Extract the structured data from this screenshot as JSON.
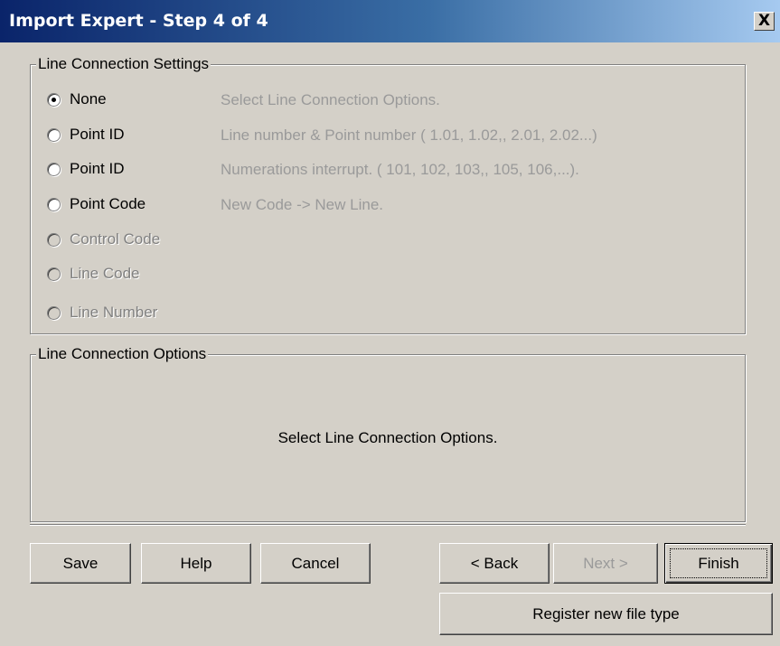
{
  "window": {
    "title": "Import Expert - Step 4 of 4",
    "close_glyph": "X"
  },
  "settings_group": {
    "legend": "Line Connection Settings",
    "options": [
      {
        "label": "None",
        "description": "Select Line Connection Options.",
        "checked": true,
        "enabled": true
      },
      {
        "label": "Point ID",
        "description": "Line number & Point number ( 1.01, 1.02,, 2.01, 2.02...)",
        "checked": false,
        "enabled": true
      },
      {
        "label": "Point ID",
        "description": "Numerations interrupt. ( 101, 102, 103,, 105, 106,...).",
        "checked": false,
        "enabled": true
      },
      {
        "label": "Point Code",
        "description": "New Code -> New Line.",
        "checked": false,
        "enabled": true
      },
      {
        "label": "Control Code",
        "description": "",
        "checked": false,
        "enabled": false
      },
      {
        "label": "Line Code",
        "description": "",
        "checked": false,
        "enabled": false
      },
      {
        "label": "Line Number",
        "description": "",
        "checked": false,
        "enabled": false
      }
    ]
  },
  "options_group": {
    "legend": "Line Connection Options",
    "message": "Select Line Connection Options."
  },
  "buttons": {
    "save": "Save",
    "help": "Help",
    "cancel": "Cancel",
    "back": "< Back",
    "next": "Next >",
    "finish": "Finish",
    "register": "Register new file type"
  },
  "colors": {
    "title_gradient_start": "#0a246a",
    "title_gradient_end": "#a6caf0",
    "dialog_face": "#d4d0c8",
    "disabled_text": "#808080"
  }
}
